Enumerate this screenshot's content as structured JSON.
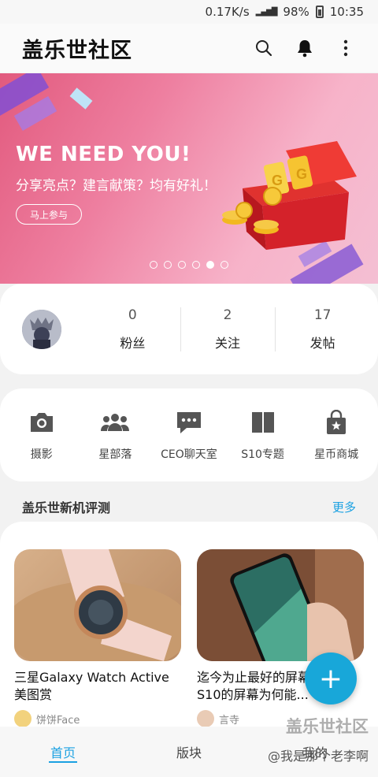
{
  "status_bar": {
    "speed": "0.17K/s",
    "battery": "98%",
    "time": "10:35"
  },
  "header": {
    "title": "盖乐世社区"
  },
  "banner": {
    "headline": "WE NEED YOU!",
    "subtitle": "分享亮点？建言献策？均有好礼！",
    "button_label": "马上参与",
    "slide_count": 6,
    "active_slide": 5
  },
  "profile": {
    "stats": [
      {
        "value": "0",
        "label": "粉丝"
      },
      {
        "value": "2",
        "label": "关注"
      },
      {
        "value": "17",
        "label": "发帖"
      }
    ]
  },
  "shortcuts": [
    {
      "label": "摄影",
      "icon": "camera-icon"
    },
    {
      "label": "星部落",
      "icon": "group-icon"
    },
    {
      "label": "CEO聊天室",
      "icon": "chat-icon"
    },
    {
      "label": "S10专题",
      "icon": "book-icon"
    },
    {
      "label": "星币商城",
      "icon": "shopping-bag-icon"
    }
  ],
  "section": {
    "title": "盖乐世新机评测",
    "more": "更多"
  },
  "reviews": [
    {
      "title": "三星Galaxy Watch Active美图赏",
      "author": "饼饼Face"
    },
    {
      "title": "迄今为止最好的屏幕，三星 S10的屏幕为何能...",
      "author": "言寺"
    }
  ],
  "fab": {
    "label": "+"
  },
  "bottom_nav": [
    {
      "label": "首页"
    },
    {
      "label": "版块"
    },
    {
      "label": "我的"
    }
  ],
  "watermark": {
    "line1": "盖乐世社区",
    "line2": "@我是那个老李啊"
  },
  "colors": {
    "accent": "#1ba1e2",
    "banner": "#e25a7e"
  }
}
